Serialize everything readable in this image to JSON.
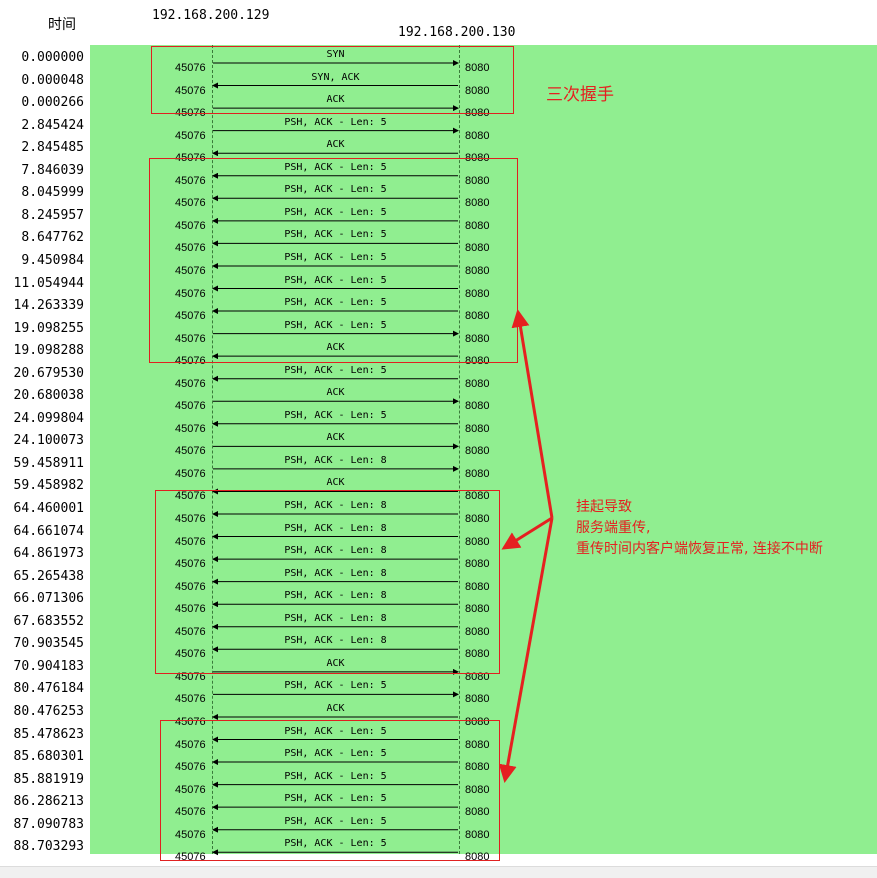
{
  "header": {
    "time_label": "时间",
    "host_a": "192.168.200.129",
    "host_b": "192.168.200.130"
  },
  "colors": {
    "background": "#90ee90",
    "annotation": "#e52020"
  },
  "rows": [
    {
      "time": "0.000000",
      "src": "45076",
      "dst": "8080",
      "label": "SYN",
      "dir": "right"
    },
    {
      "time": "0.000048",
      "src": "45076",
      "dst": "8080",
      "label": "SYN, ACK",
      "dir": "left"
    },
    {
      "time": "0.000266",
      "src": "45076",
      "dst": "8080",
      "label": "ACK",
      "dir": "right"
    },
    {
      "time": "2.845424",
      "src": "45076",
      "dst": "8080",
      "label": "PSH, ACK - Len: 5",
      "dir": "right"
    },
    {
      "time": "2.845485",
      "src": "45076",
      "dst": "8080",
      "label": "ACK",
      "dir": "left"
    },
    {
      "time": "7.846039",
      "src": "45076",
      "dst": "8080",
      "label": "PSH, ACK - Len: 5",
      "dir": "left"
    },
    {
      "time": "8.045999",
      "src": "45076",
      "dst": "8080",
      "label": "PSH, ACK - Len: 5",
      "dir": "left"
    },
    {
      "time": "8.245957",
      "src": "45076",
      "dst": "8080",
      "label": "PSH, ACK - Len: 5",
      "dir": "left"
    },
    {
      "time": "8.647762",
      "src": "45076",
      "dst": "8080",
      "label": "PSH, ACK - Len: 5",
      "dir": "left"
    },
    {
      "time": "9.450984",
      "src": "45076",
      "dst": "8080",
      "label": "PSH, ACK - Len: 5",
      "dir": "left"
    },
    {
      "time": "11.054944",
      "src": "45076",
      "dst": "8080",
      "label": "PSH, ACK - Len: 5",
      "dir": "left"
    },
    {
      "time": "14.263339",
      "src": "45076",
      "dst": "8080",
      "label": "PSH, ACK - Len: 5",
      "dir": "left"
    },
    {
      "time": "19.098255",
      "src": "45076",
      "dst": "8080",
      "label": "PSH, ACK - Len: 5",
      "dir": "right"
    },
    {
      "time": "19.098288",
      "src": "45076",
      "dst": "8080",
      "label": "ACK",
      "dir": "left"
    },
    {
      "time": "20.679530",
      "src": "45076",
      "dst": "8080",
      "label": "PSH, ACK - Len: 5",
      "dir": "left"
    },
    {
      "time": "20.680038",
      "src": "45076",
      "dst": "8080",
      "label": "ACK",
      "dir": "right"
    },
    {
      "time": "24.099804",
      "src": "45076",
      "dst": "8080",
      "label": "PSH, ACK - Len: 5",
      "dir": "left"
    },
    {
      "time": "24.100073",
      "src": "45076",
      "dst": "8080",
      "label": "ACK",
      "dir": "right"
    },
    {
      "time": "59.458911",
      "src": "45076",
      "dst": "8080",
      "label": "PSH, ACK - Len: 8",
      "dir": "right"
    },
    {
      "time": "59.458982",
      "src": "45076",
      "dst": "8080",
      "label": "ACK",
      "dir": "left"
    },
    {
      "time": "64.460001",
      "src": "45076",
      "dst": "8080",
      "label": "PSH, ACK - Len: 8",
      "dir": "left"
    },
    {
      "time": "64.661074",
      "src": "45076",
      "dst": "8080",
      "label": "PSH, ACK - Len: 8",
      "dir": "left"
    },
    {
      "time": "64.861973",
      "src": "45076",
      "dst": "8080",
      "label": "PSH, ACK - Len: 8",
      "dir": "left"
    },
    {
      "time": "65.265438",
      "src": "45076",
      "dst": "8080",
      "label": "PSH, ACK - Len: 8",
      "dir": "left"
    },
    {
      "time": "66.071306",
      "src": "45076",
      "dst": "8080",
      "label": "PSH, ACK - Len: 8",
      "dir": "left"
    },
    {
      "time": "67.683552",
      "src": "45076",
      "dst": "8080",
      "label": "PSH, ACK - Len: 8",
      "dir": "left"
    },
    {
      "time": "70.903545",
      "src": "45076",
      "dst": "8080",
      "label": "PSH, ACK - Len: 8",
      "dir": "left"
    },
    {
      "time": "70.904183",
      "src": "45076",
      "dst": "8080",
      "label": "ACK",
      "dir": "right"
    },
    {
      "time": "80.476184",
      "src": "45076",
      "dst": "8080",
      "label": "PSH, ACK - Len: 5",
      "dir": "right"
    },
    {
      "time": "80.476253",
      "src": "45076",
      "dst": "8080",
      "label": "ACK",
      "dir": "left"
    },
    {
      "time": "85.478623",
      "src": "45076",
      "dst": "8080",
      "label": "PSH, ACK - Len: 5",
      "dir": "left"
    },
    {
      "time": "85.680301",
      "src": "45076",
      "dst": "8080",
      "label": "PSH, ACK - Len: 5",
      "dir": "left"
    },
    {
      "time": "85.881919",
      "src": "45076",
      "dst": "8080",
      "label": "PSH, ACK - Len: 5",
      "dir": "left"
    },
    {
      "time": "86.286213",
      "src": "45076",
      "dst": "8080",
      "label": "PSH, ACK - Len: 5",
      "dir": "left"
    },
    {
      "time": "87.090783",
      "src": "45076",
      "dst": "8080",
      "label": "PSH, ACK - Len: 5",
      "dir": "left"
    },
    {
      "time": "88.703293",
      "src": "45076",
      "dst": "8080",
      "label": "PSH, ACK - Len: 5",
      "dir": "left"
    }
  ],
  "annotations": {
    "handshake": "三次握手",
    "retransmit_lines": [
      "挂起导致",
      "服务端重传,",
      "重传时间内客户端恢复正常, 连接不中断"
    ]
  }
}
